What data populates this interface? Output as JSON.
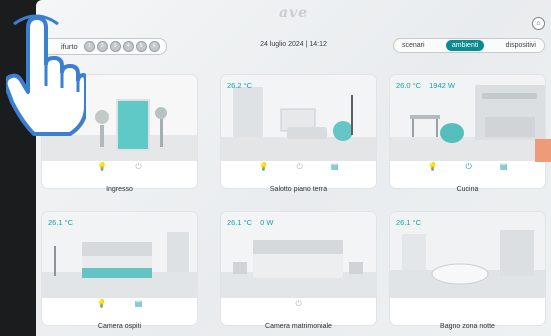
{
  "header": {
    "logo": "ave"
  },
  "antifurto": {
    "label": "ifurto",
    "zones": [
      "1",
      "2",
      "3",
      "4",
      "5",
      "6"
    ]
  },
  "datetime": "24 luglio 2024 | 14:12",
  "tabs": [
    {
      "label": "scenari",
      "active": false
    },
    {
      "label": "ambienti",
      "active": true
    },
    {
      "label": "dispositivi",
      "active": false
    }
  ],
  "rooms": [
    {
      "name": "Ingresso",
      "readouts": []
    },
    {
      "name": "Salotto piano terra",
      "readouts": [
        "26.2 °C"
      ]
    },
    {
      "name": "Cucina",
      "readouts": [
        "26.0 °C",
        "1942 W"
      ]
    },
    {
      "name": "Camera ospiti",
      "readouts": [
        "26.1 °C"
      ]
    },
    {
      "name": "Camera matrimoniale",
      "readouts": [
        "26.1 °C",
        "0 W"
      ]
    },
    {
      "name": "Bagno zona notte",
      "readouts": [
        "26.1 °C"
      ]
    }
  ],
  "colors": {
    "accent": "#0a8b8f",
    "readout": "#18a3a5",
    "highlight": "#ee9b78"
  }
}
